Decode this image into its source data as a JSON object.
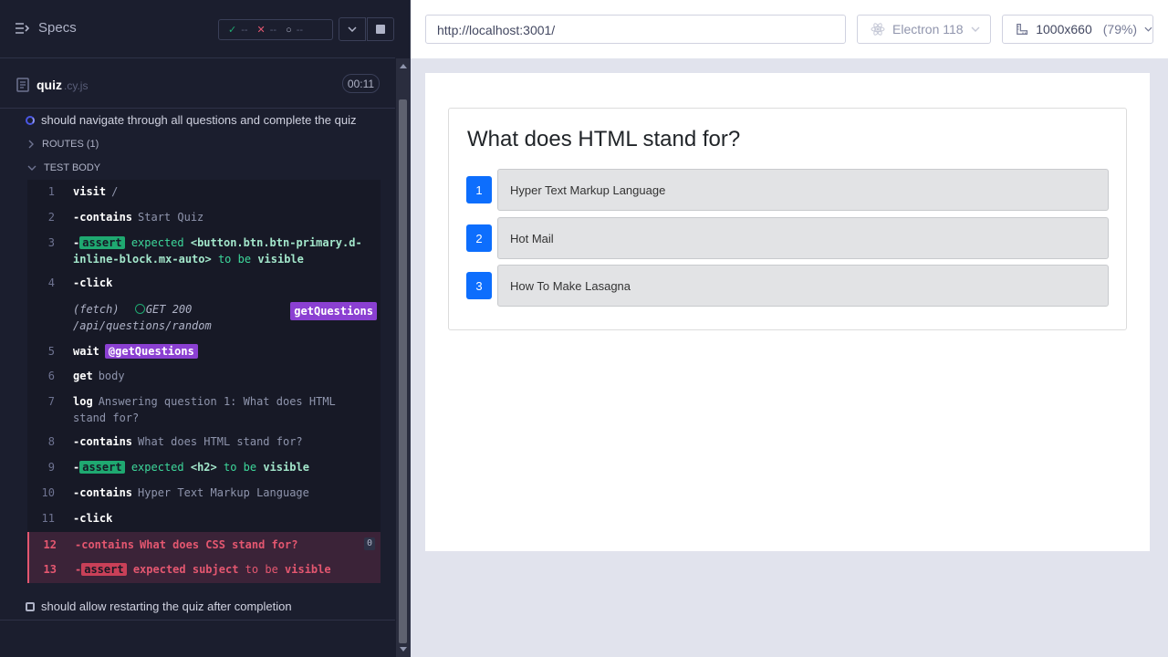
{
  "reporter": {
    "specs_label": "Specs",
    "stats": {
      "passed": "--",
      "failed": "--",
      "pending": "--"
    },
    "spec": {
      "name": "quiz",
      "ext": ".cy.js",
      "time": "00:11"
    },
    "tests": [
      {
        "title": "should navigate through all questions and complete the quiz"
      },
      {
        "title": "should allow restarting the quiz after completion"
      }
    ],
    "routes_label": "ROUTES (1)",
    "test_body_label": "TEST BODY",
    "commands": [
      {
        "num": "1",
        "cmd": "visit",
        "arg": "/"
      },
      {
        "num": "2",
        "cmd": "-contains",
        "arg": "Start Quiz"
      },
      {
        "num": "3",
        "badge": "assert",
        "expected": "expected",
        "subject": "<button.btn.btn-primary.d-inline-block.mx-auto>",
        "to_be": "to be",
        "state": "visible"
      },
      {
        "num": "4",
        "cmd": "-click"
      },
      {
        "fetch": "(fetch)",
        "method": "GET 200",
        "url": "/api/questions/random",
        "alias": "getQuestions"
      },
      {
        "num": "5",
        "cmd": "wait",
        "alias": "@getQuestions"
      },
      {
        "num": "6",
        "cmd": "get",
        "arg": "body"
      },
      {
        "num": "7",
        "cmd": "log",
        "arg": "Answering question 1: What does HTML stand for?"
      },
      {
        "num": "8",
        "cmd": "-contains",
        "arg": "What does HTML stand for?"
      },
      {
        "num": "9",
        "badge": "assert",
        "expected": "expected",
        "subject": "<h2>",
        "to_be": "to be",
        "state": "visible"
      },
      {
        "num": "10",
        "cmd": "-contains",
        "arg": "Hyper Text Markup Language"
      },
      {
        "num": "11",
        "cmd": "-click"
      },
      {
        "num": "12",
        "cmd": "-contains",
        "arg": "What does CSS stand for?",
        "count": "0"
      },
      {
        "num": "13",
        "badge": "assert",
        "expected": "expected",
        "subject": "subject",
        "to_be": "to be",
        "state": "visible"
      }
    ]
  },
  "aut": {
    "url": "http://localhost:3001/",
    "browser": "Electron 118",
    "viewport": "1000x660",
    "scale": "(79%)",
    "question": "What does HTML stand for?",
    "options": [
      {
        "num": "1",
        "label": "Hyper Text Markup Language"
      },
      {
        "num": "2",
        "label": "Hot Mail"
      },
      {
        "num": "3",
        "label": "How To Make Lasagna"
      }
    ]
  },
  "colors": {
    "accent": "#0d6efd",
    "pass": "#1fa971",
    "fail": "#e45770",
    "alias": "#8b40d2"
  }
}
